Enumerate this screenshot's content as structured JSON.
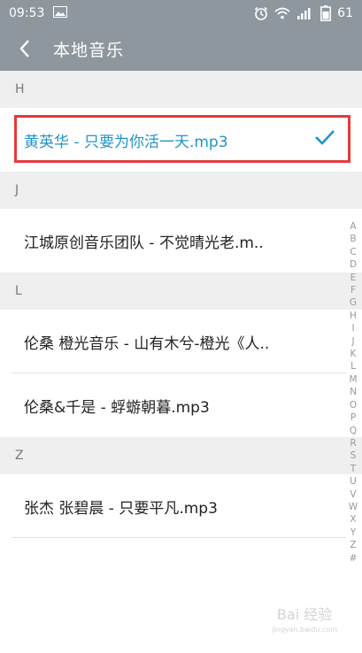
{
  "status_bar": {
    "time": "09:53",
    "battery": "61"
  },
  "header": {
    "title": "本地音乐"
  },
  "sections": [
    {
      "letter": "H",
      "items": [
        "黄英华 - 只要为你活一天.mp3"
      ]
    },
    {
      "letter": "J",
      "items": [
        "江城原创音乐团队 - 不觉晴光老.m.."
      ]
    },
    {
      "letter": "L",
      "items": [
        "伦桑 橙光音乐 - 山有木兮-橙光《人..",
        "伦桑&千是 - 蜉蝣朝暮.mp3"
      ]
    },
    {
      "letter": "Z",
      "items": [
        "张杰 张碧晨 - 只要平凡.mp3"
      ]
    }
  ],
  "selected_item": "黄英华 - 只要为你活一天.mp3",
  "alphabet_index": [
    "A",
    "B",
    "C",
    "D",
    "E",
    "F",
    "G",
    "H",
    "I",
    "J",
    "K",
    "L",
    "M",
    "N",
    "O",
    "P",
    "Q",
    "R",
    "S",
    "T",
    "U",
    "V",
    "W",
    "X",
    "Y",
    "Z",
    "#"
  ],
  "watermark": {
    "brand": "Bai 经验",
    "url": "jingyan.baidu.com"
  },
  "colors": {
    "header_bg": "#8f979e",
    "accent": "#1f95c6",
    "highlight_border": "#e53a3a"
  }
}
